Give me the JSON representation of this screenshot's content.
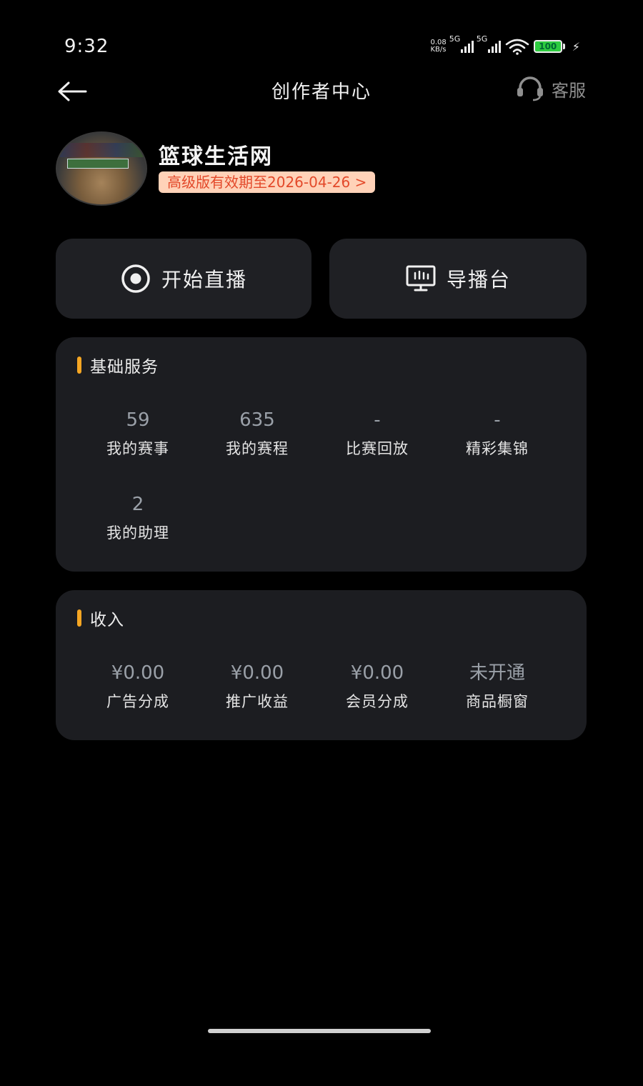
{
  "status_bar": {
    "time": "9:32",
    "net_speed_value": "0.08",
    "net_speed_unit": "KB/s",
    "signal1_label": "5G",
    "signal2_label": "5G",
    "battery": "100",
    "icons": [
      "signal-icon",
      "wifi-icon",
      "battery-icon",
      "charging-icon"
    ]
  },
  "header": {
    "title": "创作者中心",
    "service_label": "客服",
    "back_icon": "back-arrow-icon",
    "service_icon": "headset-icon"
  },
  "profile": {
    "name": "篮球生活网",
    "vip_text": "高级版有效期至2026-04-26 >",
    "vip_colors": {
      "background": "#ffd2b8",
      "text": "#e3492a"
    }
  },
  "actions": {
    "live": {
      "label": "开始直播",
      "icon": "record-icon"
    },
    "director": {
      "label": "导播台",
      "icon": "monitor-icon"
    }
  },
  "basic_services": {
    "title": "基础服务",
    "accent": "#f5a623",
    "items": [
      {
        "value": "59",
        "label": "我的赛事"
      },
      {
        "value": "635",
        "label": "我的赛程"
      },
      {
        "value": "-",
        "label": "比赛回放"
      },
      {
        "value": "-",
        "label": "精彩集锦"
      },
      {
        "value": "2",
        "label": "我的助理"
      }
    ]
  },
  "income": {
    "title": "收入",
    "accent": "#f5a623",
    "items": [
      {
        "value": "¥0.00",
        "label": "广告分成"
      },
      {
        "value": "¥0.00",
        "label": "推广收益"
      },
      {
        "value": "¥0.00",
        "label": "会员分成"
      },
      {
        "value": "未开通",
        "label": "商品橱窗"
      }
    ]
  }
}
